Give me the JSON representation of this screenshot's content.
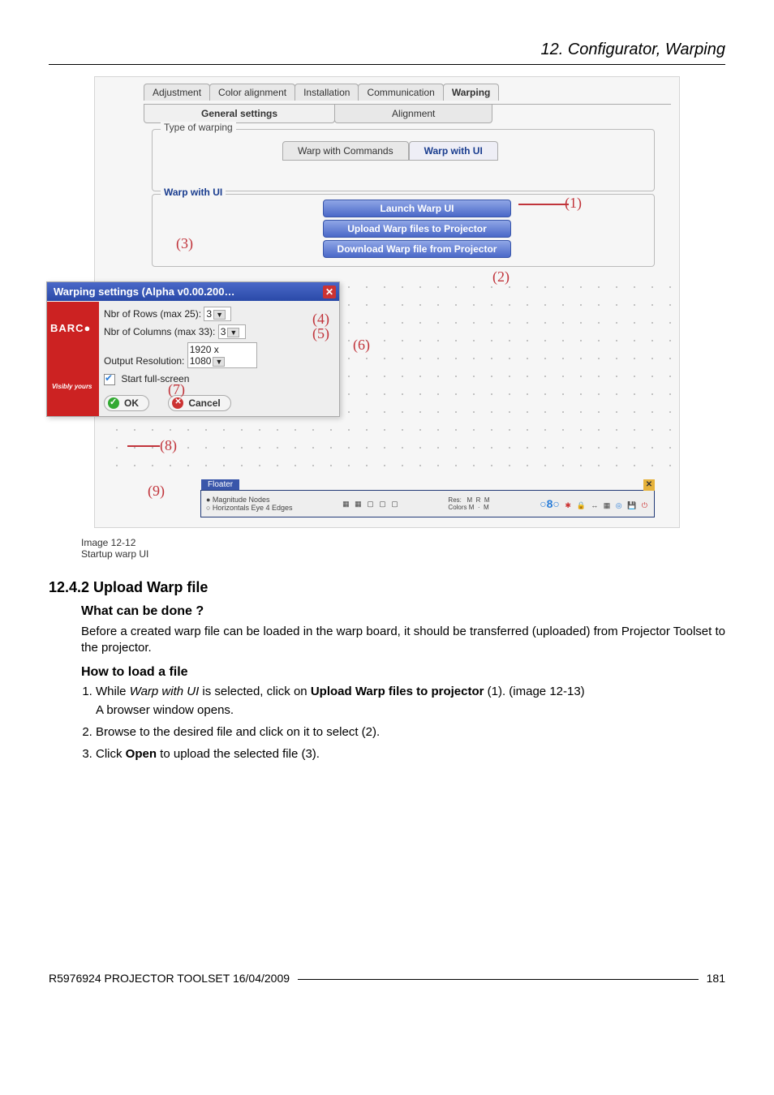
{
  "header": {
    "chapter": "12. Configurator, Warping"
  },
  "figure": {
    "tabs": {
      "adjustment": "Adjustment",
      "color": "Color alignment",
      "installation": "Installation",
      "communication": "Communication",
      "warping": "Warping"
    },
    "subtabs": {
      "general": "General settings",
      "alignment": "Alignment"
    },
    "type_box_title": "Type of warping",
    "warp_tabs": {
      "commands": "Warp with Commands",
      "ui": "Warp with UI"
    },
    "warp_box_title": "Warp with UI",
    "buttons": {
      "launch": "Launch Warp UI",
      "upload": "Upload Warp files to Projector",
      "download": "Download Warp file from Projector"
    },
    "callouts": {
      "c1": "(1)",
      "c2": "(2)",
      "c3": "(3)",
      "c4": "(4)",
      "c5": "(5)",
      "c6": "(6)",
      "c7": "(7)",
      "c8": "(8)",
      "c9": "(9)"
    },
    "dialog": {
      "title": "Warping settings (Alpha v0.00.200…",
      "close": "✕",
      "brand": "BARC●",
      "visibly": "Visibly yours",
      "row_rows_label": "Nbr of Rows (max 25):",
      "row_rows_value": "3",
      "row_cols_label": "Nbr of Columns (max 33):",
      "row_cols_value": "3",
      "row_res_label": "Output Resolution:",
      "row_res_value": "1920 x 1080",
      "start_full": "Start full-screen",
      "ok": "OK",
      "cancel": "Cancel"
    },
    "floater": {
      "label": "Floater",
      "row1": "● Magnitude Nodes",
      "row2": "○ Horizontals Eye 4 Edges",
      "mid": "Res:   M  R  M\nColors M  ·  M",
      "close": "✕"
    }
  },
  "caption": {
    "line1": "Image 12-12",
    "line2": "Startup warp UI"
  },
  "section": {
    "num_title": "12.4.2   Upload Warp file",
    "q1": "What can be done ?",
    "p1": "Before a created warp file can be loaded in the warp board, it should be transferred (uploaded) from Projector Toolset to the projector.",
    "q2": "How to load a file",
    "step1_a": "While ",
    "step1_b": "Warp with UI",
    "step1_c": " is selected, click on ",
    "step1_d": "Upload Warp files to projector",
    "step1_e": " (1). (image 12-13)",
    "step1_sub": "A browser window opens.",
    "step2": "Browse to the desired file and click on it to select (2).",
    "step3_a": "Click ",
    "step3_b": "Open",
    "step3_c": " to upload the selected file (3)."
  },
  "footer": {
    "left": "R5976924  PROJECTOR TOOLSET  16/04/2009",
    "right": "181"
  }
}
